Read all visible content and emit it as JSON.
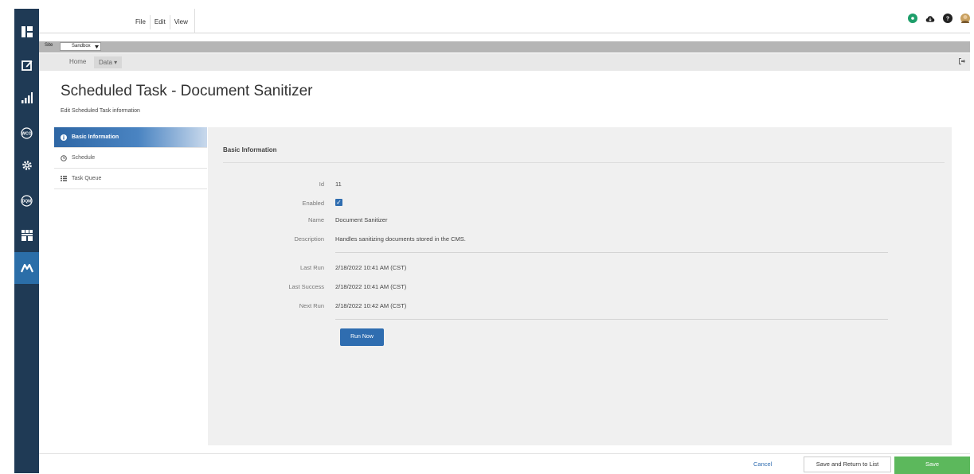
{
  "menubar": {
    "items": [
      "File",
      "Edit",
      "View"
    ]
  },
  "top_icons": [
    "badge-icon",
    "cloud-download-icon",
    "help-icon",
    "avatar"
  ],
  "sitebar": {
    "label": "Site",
    "selected": "Sandbox"
  },
  "breadcrumb": {
    "home": "Home",
    "data": "Data ▾"
  },
  "page": {
    "title": "Scheduled Task - Document Sanitizer",
    "subtitle": "Edit Scheduled Task information"
  },
  "tabs": [
    {
      "label": "Basic Information",
      "icon": "info-icon"
    },
    {
      "label": "Schedule",
      "icon": "clock-icon"
    },
    {
      "label": "Task Queue",
      "icon": "queue-icon"
    }
  ],
  "panel": {
    "heading": "Basic Information",
    "fields": {
      "id_label": "Id",
      "id_value": "11",
      "enabled_label": "Enabled",
      "enabled_value": true,
      "name_label": "Name",
      "name_value": "Document Sanitizer",
      "description_label": "Description",
      "description_value": "Handles sanitizing documents stored in the CMS.",
      "last_run_label": "Last Run",
      "last_run_value": "2/18/2022 10:41 AM (CST)",
      "last_success_label": "Last Success",
      "last_success_value": "2/18/2022 10:41 AM (CST)",
      "next_run_label": "Next Run",
      "next_run_value": "2/18/2022 10:42 AM (CST)"
    },
    "run_now": "Run Now"
  },
  "footer": {
    "cancel": "Cancel",
    "save_return": "Save and Return to List",
    "save": "Save"
  },
  "colors": {
    "nav_bg": "#1f3a55",
    "nav_active": "#2b6ea8",
    "primary": "#2f6db0",
    "success": "#5cb85c"
  }
}
